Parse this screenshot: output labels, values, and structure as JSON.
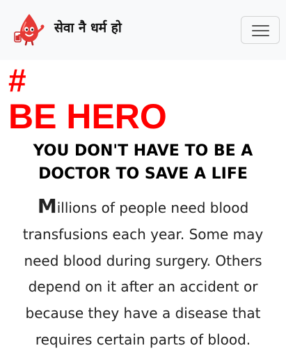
{
  "navbar": {
    "brand_text": "सेवा नै धर्म हो",
    "logo_icon": "blood-drop-mascot-icon",
    "toggler_icon": "hamburger-menu-icon"
  },
  "hero": {
    "hash": "#",
    "title": "BE HERO",
    "tagline_lines": [
      "YOU DON'T HAVE TO BE A",
      "DOCTOR TO SAVE A LIFE"
    ],
    "paragraph": {
      "drop_cap": "M",
      "first_line_rest": "illions of people need blood",
      "lines": [
        "transfusions each year. Some may",
        "need blood during surgery. Others",
        "depend on it after an accident or",
        "because they have a disease that",
        "requires certain parts of blood."
      ]
    }
  },
  "colors": {
    "accent_red": "#ff0000",
    "navbar_bg": "#f8f9fa"
  }
}
